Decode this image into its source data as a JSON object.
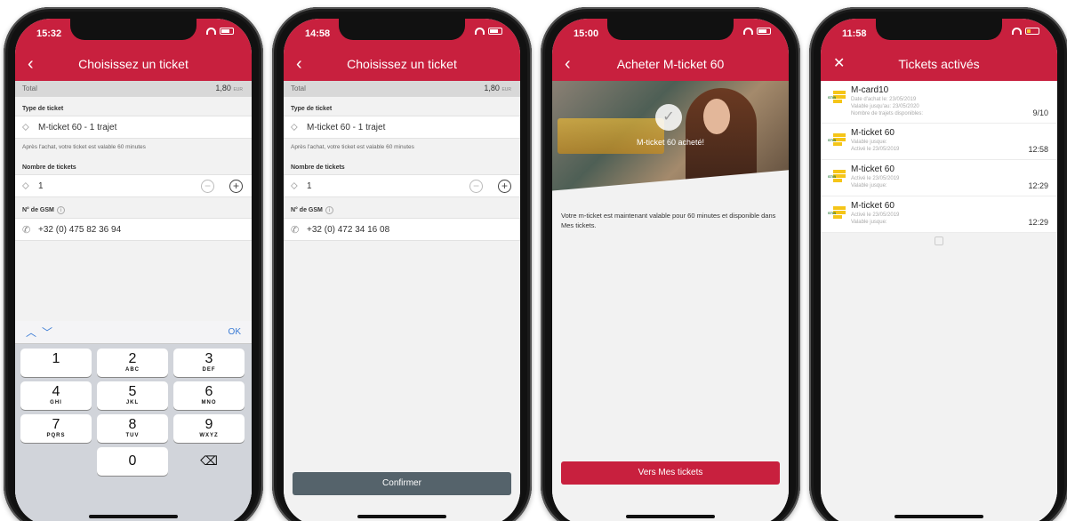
{
  "phones": {
    "p1": {
      "time": "15:32",
      "title": "Choisissez un ticket",
      "total_label": "Total",
      "total_value": "1,80",
      "total_unit": "EUR",
      "ticket_type_label": "Type de ticket",
      "ticket_type_value": "M-ticket 60 - 1 trajet",
      "hint": "Après l'achat, votre ticket est valable 60 minutes",
      "count_label": "Nombre de tickets",
      "count_value": "1",
      "gsm_label": "N° de GSM",
      "gsm_value": "+32 (0) 475 82 36 94",
      "kbd_ok": "OK",
      "keys": [
        {
          "d": "1",
          "l": ""
        },
        {
          "d": "2",
          "l": "ABC"
        },
        {
          "d": "3",
          "l": "DEF"
        },
        {
          "d": "4",
          "l": "GHI"
        },
        {
          "d": "5",
          "l": "JKL"
        },
        {
          "d": "6",
          "l": "MNO"
        },
        {
          "d": "7",
          "l": "PQRS"
        },
        {
          "d": "8",
          "l": "TUV"
        },
        {
          "d": "9",
          "l": "WXYZ"
        },
        {
          "d": "0",
          "l": ""
        }
      ]
    },
    "p2": {
      "time": "14:58",
      "title": "Choisissez un ticket",
      "total_label": "Total",
      "total_value": "1,80",
      "total_unit": "EUR",
      "ticket_type_label": "Type de ticket",
      "ticket_type_value": "M-ticket 60 - 1 trajet",
      "hint": "Après l'achat, votre ticket est valable 60 minutes",
      "count_label": "Nombre de tickets",
      "count_value": "1",
      "gsm_label": "N° de GSM",
      "gsm_value": "+32 (0) 472 34 16 08",
      "confirm_label": "Confirmer"
    },
    "p3": {
      "time": "15:00",
      "title": "Acheter M-ticket 60",
      "bought_text": "M-ticket 60 acheté!",
      "message": "Votre m-ticket est maintenant valable pour 60 minutes et disponible dans Mes tickets.",
      "button_label": "Vers Mes tickets"
    },
    "p4": {
      "time": "11:58",
      "title": "Tickets activés",
      "tickets": [
        {
          "name": "M-card10",
          "sub1": "Date d'achat le: 23/05/2019",
          "sub2": "Valable jusqu'au: 23/05/2020",
          "sub3": "Nombre de trajets disponibles:",
          "value": "9/10"
        },
        {
          "name": "M-ticket 60",
          "sub1": "Valable jusque:",
          "sub2": "Activé le 23/05/2019",
          "sub3": "",
          "value": "12:58"
        },
        {
          "name": "M-ticket 60",
          "sub1": "Activé le 23/05/2019",
          "sub2": "Valable jusque:",
          "sub3": "",
          "value": "12:29"
        },
        {
          "name": "M-ticket 60",
          "sub1": "Activé le 23/05/2019",
          "sub2": "Valable jusque:",
          "sub3": "",
          "value": "12:29"
        }
      ]
    }
  },
  "colors": {
    "brand": "#c8203e",
    "confirm": "#55636b",
    "link_blue": "#3a7bd5"
  },
  "icons": {
    "back": "chevron-left-icon",
    "close": "close-icon",
    "ticket": "ticket-icon",
    "phone": "phone-icon",
    "minus": "minus-circle-icon",
    "plus": "plus-circle-icon",
    "info": "info-icon",
    "backspace": "backspace-icon",
    "check": "check-icon",
    "wifi": "wifi-icon",
    "battery": "battery-icon"
  }
}
